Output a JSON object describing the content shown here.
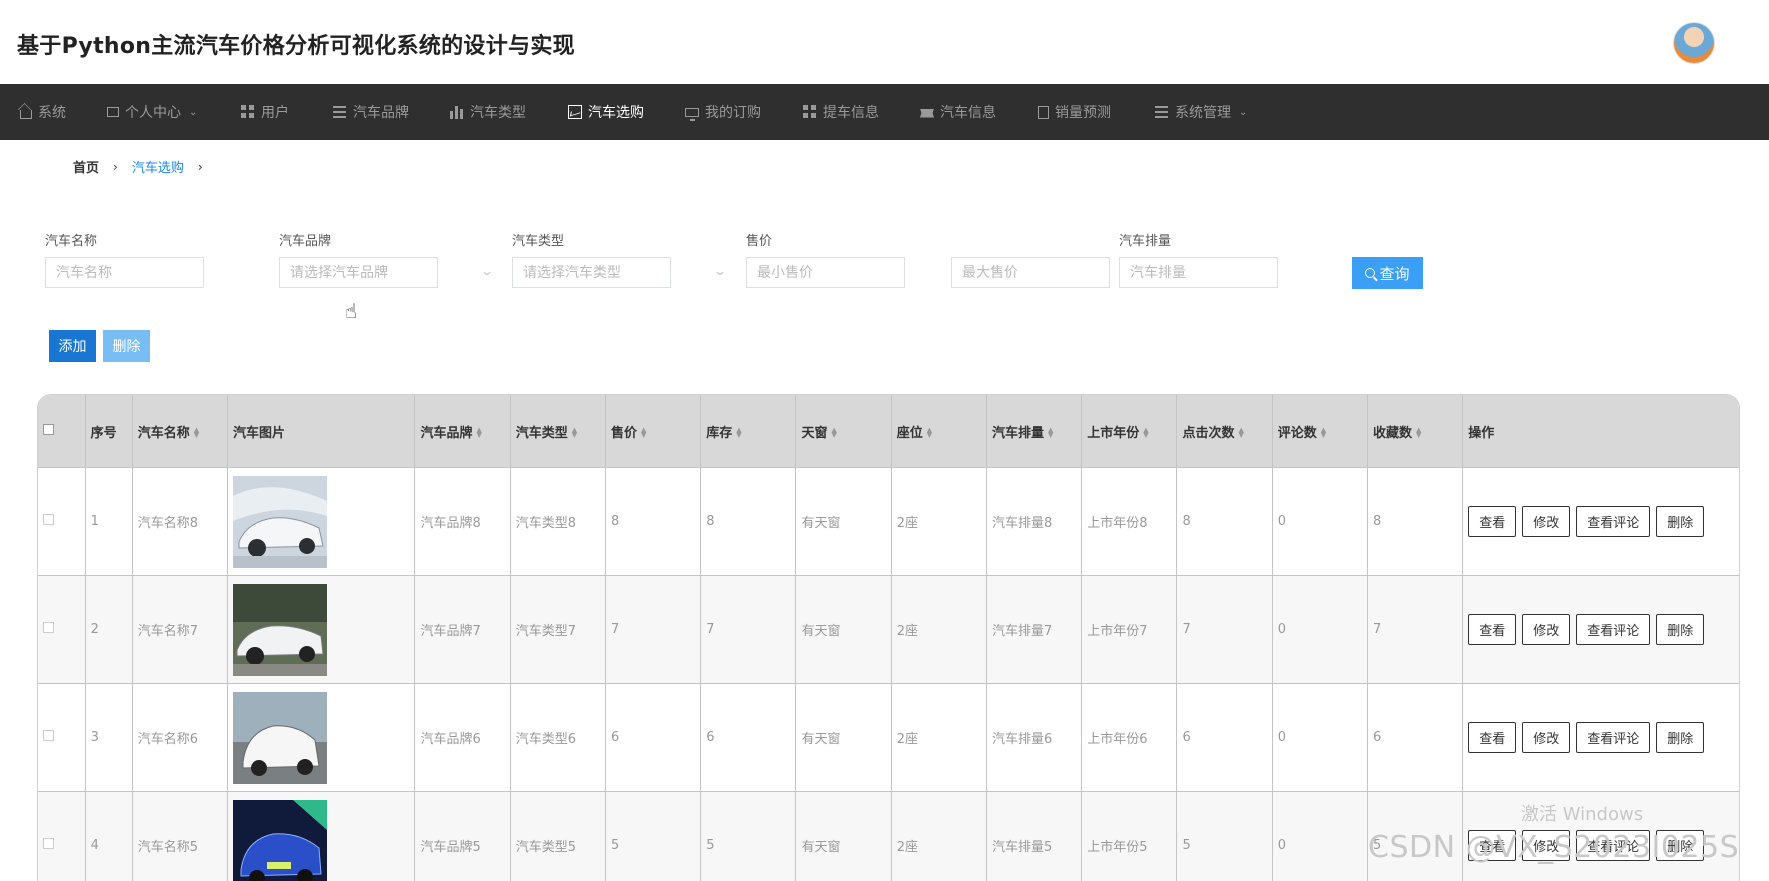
{
  "header": {
    "title": "基于Python主流汽车价格分析可视化系统的设计与实现"
  },
  "nav": [
    {
      "label": "系统",
      "icon": "home-icon"
    },
    {
      "label": "个人中心",
      "icon": "window-icon",
      "dropdown": true
    },
    {
      "label": "用户",
      "icon": "grid-icon"
    },
    {
      "label": "汽车品牌",
      "icon": "list-icon"
    },
    {
      "label": "汽车类型",
      "icon": "bar-chart-icon"
    },
    {
      "label": "汽车选购",
      "icon": "line-chart-icon",
      "active": true
    },
    {
      "label": "我的订购",
      "icon": "monitor-icon"
    },
    {
      "label": "提车信息",
      "icon": "grid-icon"
    },
    {
      "label": "汽车信息",
      "icon": "ticket-icon"
    },
    {
      "label": "销量预测",
      "icon": "clipboard-icon"
    },
    {
      "label": "系统管理",
      "icon": "list-icon",
      "dropdown": true
    }
  ],
  "breadcrumb": {
    "home": "首页",
    "current": "汽车选购"
  },
  "filters": {
    "name_label": "汽车名称",
    "name_placeholder": "汽车名称",
    "brand_label": "汽车品牌",
    "brand_placeholder": "请选择汽车品牌",
    "type_label": "汽车类型",
    "type_placeholder": "请选择汽车类型",
    "price_label": "售价",
    "min_price_placeholder": "最小售价",
    "max_price_placeholder": "最大售价",
    "displacement_label": "汽车排量",
    "displacement_placeholder": "汽车排量",
    "query_label": "查询"
  },
  "actions": {
    "add": "添加",
    "delete": "删除"
  },
  "table": {
    "columns": [
      "序号",
      "汽车名称",
      "汽车图片",
      "汽车品牌",
      "汽车类型",
      "售价",
      "库存",
      "天窗",
      "座位",
      "汽车排量",
      "上市年份",
      "点击次数",
      "评论数",
      "收藏数",
      "操作"
    ],
    "row_actions": [
      "查看",
      "修改",
      "查看评论",
      "删除"
    ],
    "rows": [
      {
        "index": "1",
        "name": "汽车名称8",
        "brand": "汽车品牌8",
        "type": "汽车类型8",
        "price": "8",
        "stock": "8",
        "sunroof": "有天窗",
        "seats": "2座",
        "displacement": "汽车排量8",
        "year": "上市年份8",
        "clicks": "8",
        "comments": "0",
        "favorites": "8",
        "img_color": "#c9d3dd"
      },
      {
        "index": "2",
        "name": "汽车名称7",
        "brand": "汽车品牌7",
        "type": "汽车类型7",
        "price": "7",
        "stock": "7",
        "sunroof": "有天窗",
        "seats": "2座",
        "displacement": "汽车排量7",
        "year": "上市年份7",
        "clicks": "7",
        "comments": "0",
        "favorites": "7",
        "img_color": "#5d6b52"
      },
      {
        "index": "3",
        "name": "汽车名称6",
        "brand": "汽车品牌6",
        "type": "汽车类型6",
        "price": "6",
        "stock": "6",
        "sunroof": "有天窗",
        "seats": "2座",
        "displacement": "汽车排量6",
        "year": "上市年份6",
        "clicks": "6",
        "comments": "0",
        "favorites": "6",
        "img_color": "#8fa0ad"
      },
      {
        "index": "4",
        "name": "汽车名称5",
        "brand": "汽车品牌5",
        "type": "汽车类型5",
        "price": "5",
        "stock": "5",
        "sunroof": "有天窗",
        "seats": "2座",
        "displacement": "汽车排量5",
        "year": "上市年份5",
        "clicks": "5",
        "comments": "0",
        "favorites": "5",
        "img_color": "#1b2a6b"
      }
    ]
  },
  "watermarks": {
    "windows": "激活 Windows",
    "csdn": "CSDN @VX_S2023I025S"
  },
  "colors": {
    "nav_bg": "#2f2f2f",
    "accent": "#1976d2",
    "query": "#3a9ff5"
  }
}
